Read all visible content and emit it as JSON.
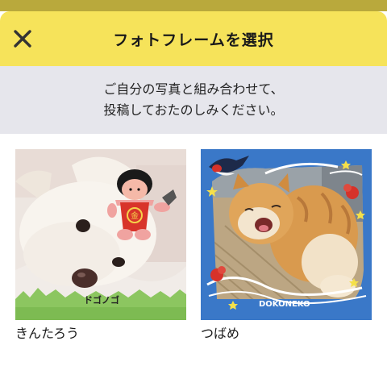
{
  "header": {
    "title": "フォトフレームを選択",
    "close_icon": "close-icon"
  },
  "notice": {
    "line1": "ご自分の写真と組み合わせて、",
    "line2": "投稿しておたのしみください。"
  },
  "frames": [
    {
      "name": "きんたろう",
      "stamp": "ドゴノゴ"
    },
    {
      "name": "つばめ",
      "stamp": "DOKONEKO"
    }
  ],
  "colors": {
    "header_bg": "#f6e35a",
    "notice_bg": "#e6e6ec",
    "tsubame_frame": "#3a78c8"
  }
}
